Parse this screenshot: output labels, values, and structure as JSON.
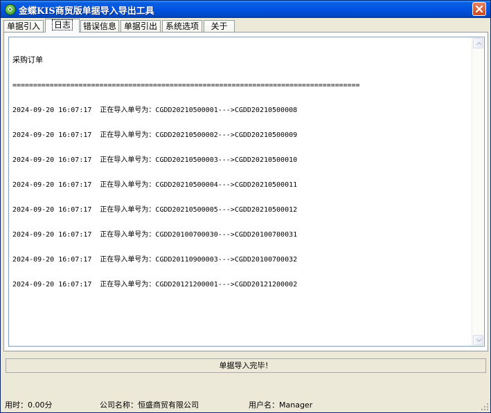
{
  "window": {
    "title": "金蝶KIS商贸版单据导入导出工具"
  },
  "tabs": [
    {
      "label": "单据引入"
    },
    {
      "label": "日志"
    },
    {
      "label": "错误信息"
    },
    {
      "label": "单据引出"
    },
    {
      "label": "系统选项"
    },
    {
      "label": "关于"
    }
  ],
  "log": {
    "heading": "采购订单",
    "separator": "====================================================================================",
    "entries": [
      "2024-09-20 16:07:17  正在导入单号为：CGDD20210500001--->CGDD20210500008",
      "2024-09-20 16:07:17  正在导入单号为：CGDD20210500002--->CGDD20210500009",
      "2024-09-20 16:07:17  正在导入单号为：CGDD20210500003--->CGDD20210500010",
      "2024-09-20 16:07:17  正在导入单号为：CGDD20210500004--->CGDD20210500011",
      "2024-09-20 16:07:17  正在导入单号为：CGDD20210500005--->CGDD20210500012",
      "2024-09-20 16:07:17  正在导入单号为：CGDD20100700030--->CGDD20100700031",
      "2024-09-20 16:07:17  正在导入单号为：CGDD20110900003--->CGDD20100700032",
      "2024-09-20 16:07:17  正在导入单号为：CGDD20121200001--->CGDD20121200002"
    ]
  },
  "status_message": "单据导入完毕！",
  "statusbar": {
    "time": "用时：0.00分",
    "company": "公司名称：恒盛商贸有限公司",
    "user": "用户名：Manager"
  },
  "icons": {
    "app": "kingdee-app-icon",
    "close": "close-icon",
    "scroll_up": "scroll-up-arrow-icon",
    "scroll_down": "scroll-down-arrow-icon",
    "grip": "resize-grip-icon"
  },
  "colors": {
    "titlebar": "#0054e3",
    "window_bg": "#ece9d8",
    "close_button": "#c94a26"
  }
}
